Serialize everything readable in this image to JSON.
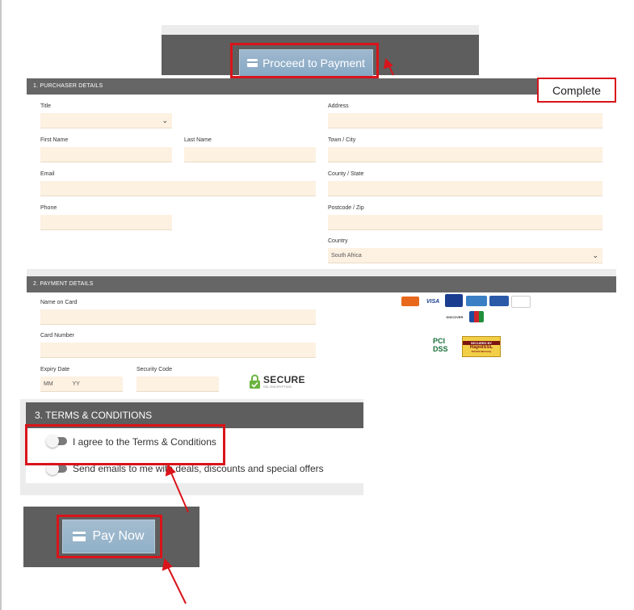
{
  "proceed": {
    "label": "Proceed to Payment",
    "icon": "credit-card-icon"
  },
  "complete_label": "Complete",
  "purchaser": {
    "heading": "1. PURCHASER DETAILS",
    "title_label": "Title",
    "first_name_label": "First Name",
    "last_name_label": "Last Name",
    "email_label": "Email",
    "phone_label": "Phone",
    "address_label": "Address",
    "town_label": "Town / City",
    "county_label": "County / State",
    "postcode_label": "Postcode / Zip",
    "country_label": "Country",
    "country_value": "South Africa"
  },
  "payment": {
    "heading": "2. PAYMENT DETAILS",
    "name_on_card_label": "Name on Card",
    "card_number_label": "Card Number",
    "expiry_label": "Expiry Date",
    "expiry_mm_placeholder": "MM",
    "expiry_yy_placeholder": "YY",
    "security_code_label": "Security Code",
    "secure_title": "SECURE",
    "secure_subtitle": "SSL ENCRYPTION",
    "card_logos": [
      "Mastercard",
      "VISA",
      "VISA Electron",
      "American Express",
      "Maestro",
      "Diners Club",
      "DISCOVER",
      "JCB"
    ],
    "pci_label": "PCI DSS",
    "rapidssl": {
      "secured_by": "SECURED BY",
      "brand": "RapidSSL",
      "warranty": "$10,000 Warranty"
    }
  },
  "terms": {
    "heading": "3. TERMS & CONDITIONS",
    "agree_label": "I agree to the Terms & Conditions",
    "emails_label": "Send emails to me with deals, discounts and special offers"
  },
  "pay_now": {
    "label": "Pay Now",
    "icon": "credit-card-icon"
  },
  "colors": {
    "highlight": "#d9141a",
    "header": "#666666",
    "field": "#fdf1e2",
    "button": "#8fb0c7"
  }
}
